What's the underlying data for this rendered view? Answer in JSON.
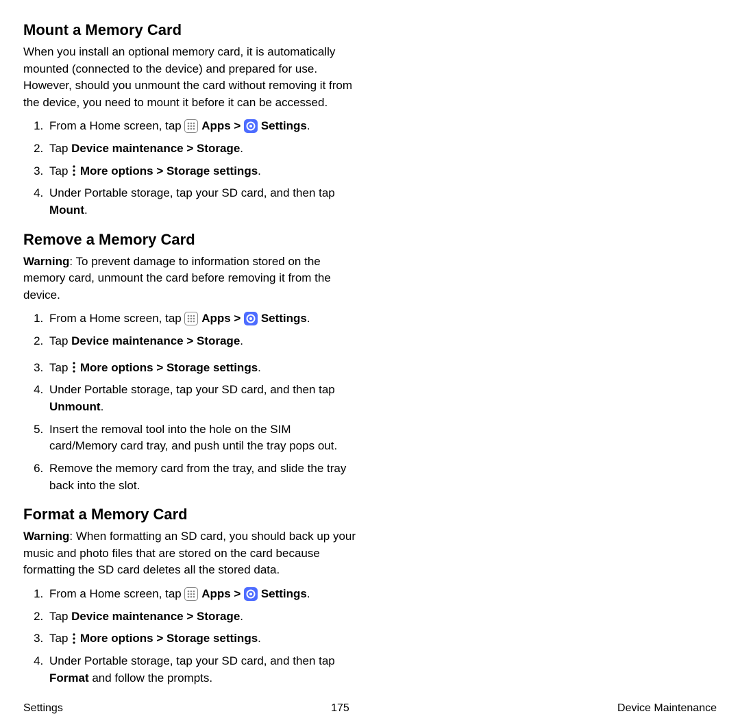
{
  "sections": {
    "mount": {
      "heading": "Mount a Memory Card",
      "intro": "When you install an optional memory card, it is automatically mounted (connected to the device) and prepared for use. However, should you unmount the card without removing it from the device, you need to mount it before it can be accessed.",
      "s1_a": "From a Home screen, tap ",
      "s1_apps": "Apps",
      "s1_sep": " > ",
      "s1_settings": "Settings",
      "s1_end": ".",
      "s2_a": "Tap ",
      "s2_b": "Device maintenance > Storage",
      "s2_c": ".",
      "s3_a": "Tap ",
      "s3_b": "More options > Storage settings",
      "s3_c": ".",
      "s4_a": "Under Portable storage, tap your SD card, and then tap ",
      "s4_b": "Mount",
      "s4_c": "."
    },
    "remove": {
      "heading": "Remove a Memory Card",
      "warn_label": "Warning",
      "warn_text": ": To prevent damage to information stored on the memory card, unmount the card before removing it from the device.",
      "s1_a": "From a Home screen, tap ",
      "s1_apps": "Apps",
      "s1_sep": " > ",
      "s1_settings": "Settings",
      "s1_end": ".",
      "s2_a": "Tap ",
      "s2_b": "Device maintenance > Storage",
      "s2_c": ".",
      "s3_a": "Tap ",
      "s3_b": "More options > Storage settings",
      "s3_c": ".",
      "s4_a": "Under Portable storage, tap your SD card, and then tap ",
      "s4_b": "Unmount",
      "s4_c": ".",
      "s5": "Insert the removal tool into the hole on the SIM card/Memory card tray, and push until the tray pops out.",
      "s6": "Remove the memory card from the tray, and slide the tray back into the slot."
    },
    "format": {
      "heading": "Format a Memory Card",
      "warn_label": "Warning",
      "warn_text": ": When formatting an SD card, you should back up your music and photo files that are stored on the card because formatting the SD card deletes all the stored data.",
      "s1_a": "From a Home screen, tap ",
      "s1_apps": "Apps",
      "s1_sep": " > ",
      "s1_settings": "Settings",
      "s1_end": ".",
      "s2_a": "Tap ",
      "s2_b": "Device maintenance > Storage",
      "s2_c": ".",
      "s3_a": "Tap ",
      "s3_b": "More options > Storage settings",
      "s3_c": ".",
      "s4_a": "Under Portable storage, tap your SD card, and then tap ",
      "s4_b": "Format",
      "s4_c": " and follow the prompts."
    }
  },
  "footer": {
    "left": "Settings",
    "center": "175",
    "right": "Device Maintenance"
  }
}
